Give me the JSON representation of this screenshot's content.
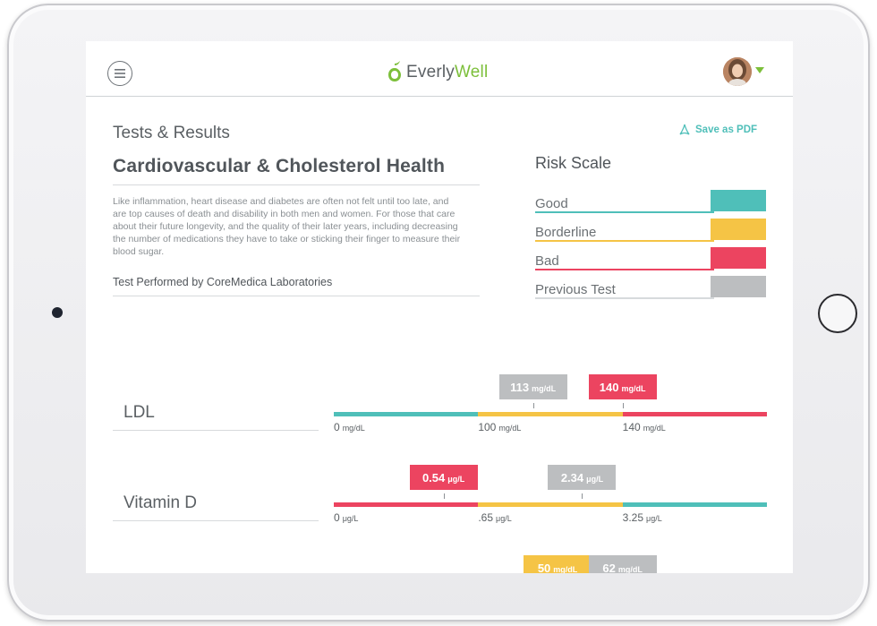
{
  "colors": {
    "good": "#4fbfb9",
    "borderline": "#f5c445",
    "bad": "#ec4460",
    "previous": "#bcbec0",
    "brand_accent": "#7cbf3a"
  },
  "header": {
    "menu_icon": "menu-icon",
    "brand_name_prefix": "Everly",
    "brand_name_suffix": "Well",
    "avatar_icon": "user-avatar"
  },
  "page": {
    "section_heading": "Tests & Results",
    "title": "Cardiovascular & Cholesterol Health",
    "description": "Like inflammation, heart disease and diabetes are often not felt until too late, and are top causes of death and disability in both men and women. For those that care about their future longevity, and the quality of their later years, including decreasing the number of medications they have to take or sticking their finger to measure their blood sugar.",
    "lab_line": "Test Performed by CoreMedica Laboratories",
    "save_pdf_label": "Save as PDF"
  },
  "risk_scale": {
    "title": "Risk Scale",
    "items": [
      {
        "label": "Good",
        "key": "good"
      },
      {
        "label": "Borderline",
        "key": "borderline"
      },
      {
        "label": "Bad",
        "key": "bad"
      },
      {
        "label": "Previous Test",
        "key": "previous"
      }
    ]
  },
  "results": [
    {
      "name": "LDL",
      "segments": [
        "good",
        "borderline",
        "bad"
      ],
      "axis": [
        {
          "value": "0",
          "unit": "mg/dL"
        },
        {
          "value": "100",
          "unit": "mg/dL"
        },
        {
          "value": "140",
          "unit": "mg/dL"
        }
      ],
      "markers": [
        {
          "value": "113",
          "unit": "mg/dL",
          "kind": "previous",
          "segment_index": 1,
          "fraction": 0.38
        },
        {
          "value": "140",
          "unit": "mg/dL",
          "kind": "bad",
          "segment_index": 2,
          "fraction": 0.0
        }
      ]
    },
    {
      "name": "Vitamin D",
      "segments": [
        "bad",
        "borderline",
        "good"
      ],
      "axis": [
        {
          "value": "0",
          "unit": "μg/L"
        },
        {
          "value": ".65",
          "unit": "μg/L"
        },
        {
          "value": "3.25",
          "unit": "μg/L"
        }
      ],
      "markers": [
        {
          "value": "0.54",
          "unit": "μg/L",
          "kind": "bad",
          "segment_index": 0,
          "fraction": 0.76
        },
        {
          "value": "2.34",
          "unit": "μg/L",
          "kind": "previous",
          "segment_index": 1,
          "fraction": 0.72
        }
      ]
    },
    {
      "name": "",
      "segments": [],
      "axis": [],
      "markers": [
        {
          "value": "50",
          "unit": "mg/dL",
          "kind": "borderline",
          "segment_index": 1,
          "fraction": 0.55
        },
        {
          "value": "62",
          "unit": "mg/dL",
          "kind": "previous",
          "segment_index": 2,
          "fraction": 0.0
        }
      ]
    }
  ]
}
